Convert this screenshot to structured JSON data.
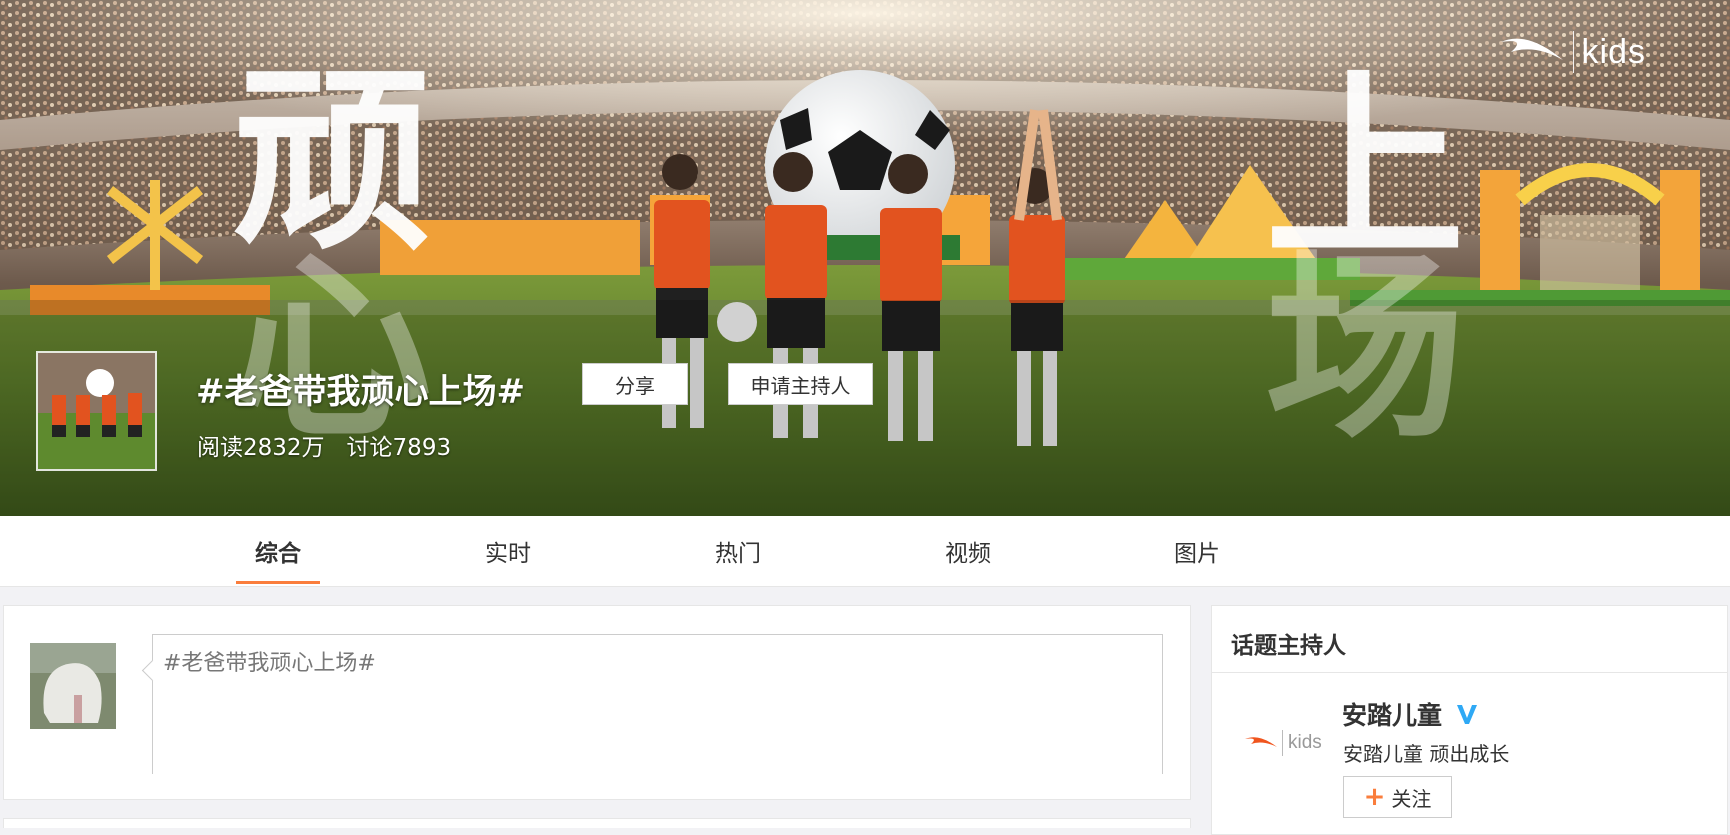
{
  "banner": {
    "brand_logo_text": "kids",
    "big_chars": [
      "顽",
      "心",
      "上",
      "场"
    ]
  },
  "topic": {
    "title": "#老爸带我顽心上场#",
    "share_label": "分享",
    "apply_host_label": "申请主持人",
    "reads": "阅读2832万",
    "discussions": "讨论7893"
  },
  "tabs": [
    {
      "label": "综合",
      "active": true
    },
    {
      "label": "实时"
    },
    {
      "label": "热门"
    },
    {
      "label": "视频"
    },
    {
      "label": "图片"
    }
  ],
  "composer": {
    "input_value": "#老爸带我顽心上场#"
  },
  "host_panel": {
    "title": "话题主持人",
    "logo_text": "kids",
    "name": "安踏儿童",
    "description": "安踏儿童 顽出成长",
    "follow_label": "关注",
    "verified_color": "#2fa9f5"
  },
  "colors": {
    "accent": "#fa7d3c",
    "page_bg": "#f2f2f5"
  }
}
